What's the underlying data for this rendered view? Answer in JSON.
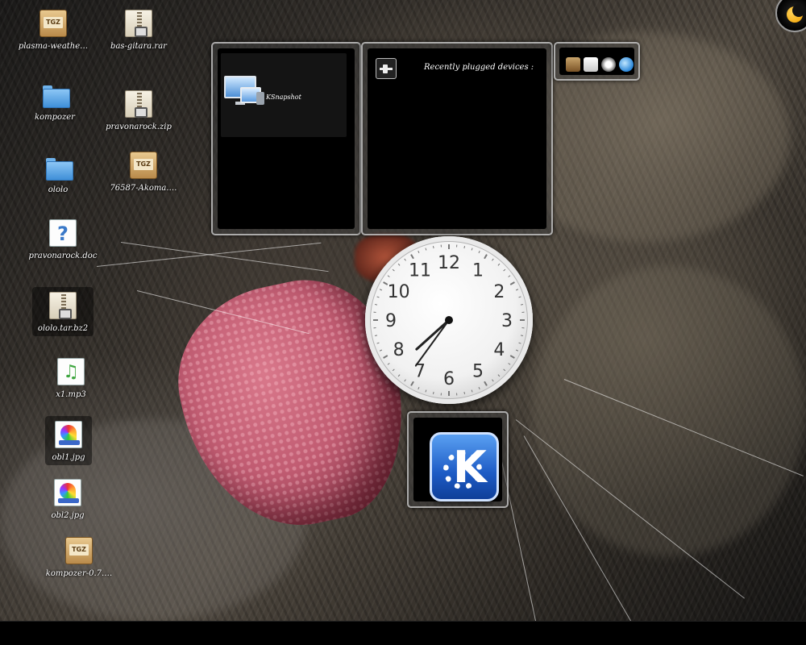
{
  "desktop": {
    "icons": [
      {
        "label": "plasma-weathe…",
        "icon": "tgz-archive-icon"
      },
      {
        "label": "bas-gitara.rar",
        "icon": "zip-archive-icon"
      },
      {
        "label": "kompozer",
        "icon": "folder-icon"
      },
      {
        "label": "pravonarock.zip",
        "icon": "zip-archive-icon"
      },
      {
        "label": "ololo",
        "icon": "folder-icon"
      },
      {
        "label": "76587-Akoma.…",
        "icon": "tgz-archive-icon"
      },
      {
        "label": "pravonarock.doc",
        "icon": "unknown-document-icon"
      },
      {
        "label": "ololo.tar.bz2",
        "icon": "zip-archive-icon"
      },
      {
        "label": "x1.mp3",
        "icon": "audio-file-icon"
      },
      {
        "label": "obl1.jpg",
        "icon": "image-file-icon"
      },
      {
        "label": "obl2.jpg",
        "icon": "image-file-icon"
      },
      {
        "label": "kompozer-0.7.…",
        "icon": "tgz-archive-icon"
      }
    ]
  },
  "widgets": {
    "app_launcher": {
      "item_label": "KSnapshot",
      "item_icon": "ksnapshot-icon"
    },
    "device_notifier": {
      "title": "Recently plugged devices :",
      "icon": "device-plug-icon"
    },
    "quicklaunch": {
      "icons": [
        "home-folder-icon",
        "files-icon",
        "network-icon",
        "konqueror-icon"
      ]
    },
    "analog_clock": {
      "hour": 7,
      "minute": 36,
      "numerals": [
        "12",
        "1",
        "2",
        "3",
        "4",
        "5",
        "6",
        "7",
        "8",
        "9",
        "10",
        "11"
      ]
    },
    "kde_logo": {
      "icon": "kde-logo-icon"
    }
  },
  "corner_toolbox": {
    "icon": "plasma-cashew-icon"
  }
}
